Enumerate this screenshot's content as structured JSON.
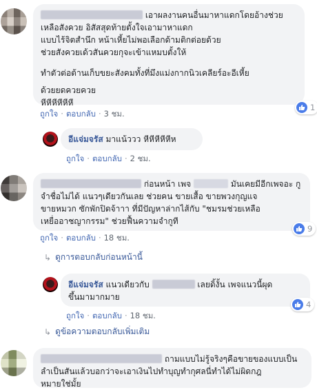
{
  "comments": [
    {
      "text_line1": "เอาผลงานคนอื่นมาหาแดกโดยอ้างช่วย",
      "text_line2": "เหลือสังควย อิสัสสุดท้ายตั้งใจเอามาหาแดก",
      "text_line3": "แบบไร้จิตสำนึก หน้าเหี้ยไม่พอเลือกด้ามติกต่อยด้วย",
      "text_line4": "ช่วยสังควยเด้วสันควยกุจะเข้าแหมบตั้งให้",
      "text_line5": "ทำตัวต่อต้านเก็บขยะสังคมทั้งที่มึงแม่งกากนิวเคลียร์อะอีเหี้ย",
      "text_line6": "ด้วยยดควยควย",
      "text_line7": "หีหีหีหีหีหี",
      "like_label": "ถูกใจ",
      "reply_label": "ตอบกลับ",
      "time": "3 ชม.",
      "reaction_count": "1"
    },
    {
      "author": "อีแจ่มจรัส",
      "text": "มาแน้ววว หีหีหีหีหีห",
      "like_label": "ถูกใจ",
      "reply_label": "ตอบกลับ",
      "time": "2 ชม."
    },
    {
      "text_a": "ก่อนหน้า เพจ",
      "text_b": "มันเคยมีอีกเพจอะ กู",
      "text_line2": "จำชื่อไม่ได้ แนวๆเดียวกันเลย ช่วยคน ขายเสื้อ ขายพวงกุญแจ",
      "text_line3": "ขายหมวก ซักพักปิดจ้าาา ที่มีปัญหาล่ากไส้กับ \"ชมรมช่วยเหลือ",
      "text_line4": "เหยื่ออาชญากรรม\" ช่วยฟื้นความจำกูที",
      "like_label": "ถูกใจ",
      "reply_label": "ตอบกลับ",
      "time": "18 ชม.",
      "reaction_count": "9"
    },
    {
      "author": "อีแจ่มจรัส",
      "text_a": "แนวเดียวกับ",
      "text_b": "เลยดิ้งั้น เพจแนวนี้ผุด",
      "text_line2": "ขึ้นมามากมาย",
      "like_label": "ถูกใจ",
      "reply_label": "ตอบกลับ",
      "time": "18 ชม.",
      "reaction_count": "4"
    },
    {
      "text_a": "ถามแบบไม่รู้จริงๆคือขายของแบบเป็น",
      "text_line2": "ลำเป็นสันแล้วบอกว่าจะเอาเงินไปทำบุญทำกุศลนี่ทำได้ไม่ผิดกฎ",
      "text_line3": "หมายใช่มั้ย"
    }
  ],
  "links": {
    "previous_replies": "ดูการตอบกลับก่อนหน้านี้",
    "more_replies": "ดูข้อความตอบกลับเพิ่มเติม"
  },
  "colors": {
    "link": "#385898",
    "bubble": "#f2f3f5",
    "like": "#4a7ce9"
  },
  "icons": [
    "thumbs-up-icon",
    "reply-arrow-icon"
  ]
}
